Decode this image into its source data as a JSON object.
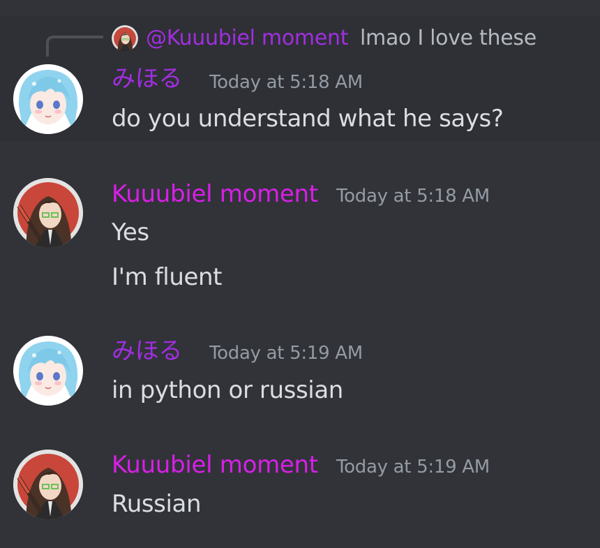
{
  "colors": {
    "background": "#313338",
    "highlight_background": "#2e3035",
    "mihoru_name": "#a12ee0",
    "kuuubiel_name": "#d81fe8",
    "message_text": "#dbdee1",
    "timestamp": "#949ba4",
    "reply_text": "#b5bac1"
  },
  "reply": {
    "mention": "@Kuuubiel moment",
    "preview": "lmao I love these",
    "avatar_icon": "kuuubiel-avatar-icon"
  },
  "messages": [
    {
      "author": "みほる",
      "timestamp": "Today at 5:18 AM",
      "avatar_icon": "mihoru-avatar-icon",
      "lines": [
        "do you understand what he says?"
      ]
    },
    {
      "author": "Kuuubiel moment",
      "timestamp": "Today at 5:18 AM",
      "avatar_icon": "kuuubiel-avatar-icon",
      "lines": [
        "Yes",
        "I'm fluent"
      ]
    },
    {
      "author": "みほる",
      "timestamp": "Today at 5:19 AM",
      "avatar_icon": "mihoru-avatar-icon",
      "lines": [
        "in python or russian"
      ]
    },
    {
      "author": "Kuuubiel moment",
      "timestamp": "Today at 5:19 AM",
      "avatar_icon": "kuuubiel-avatar-icon",
      "lines": [
        "Russian"
      ]
    }
  ]
}
